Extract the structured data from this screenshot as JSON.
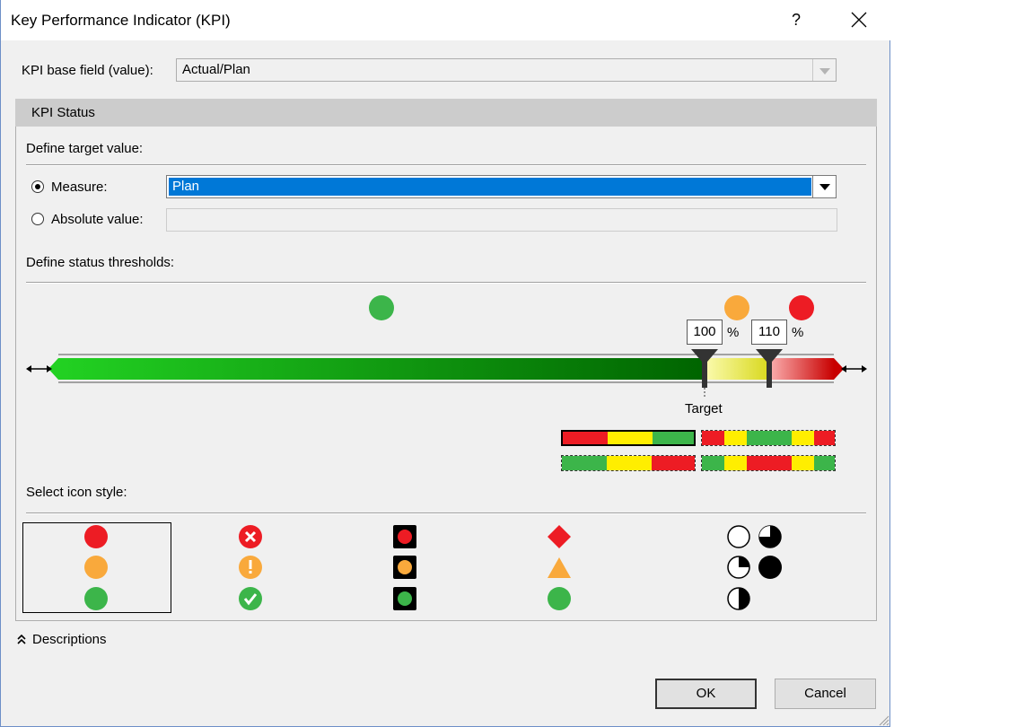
{
  "dialog": {
    "title": "Key Performance Indicator (KPI)",
    "help_label": "?",
    "close_label": "✕"
  },
  "base_field": {
    "label": "KPI base field (value):",
    "value": "Actual/Plan"
  },
  "kpi_status": {
    "header": "KPI Status",
    "define_target_label": "Define target value:",
    "measure_label": "Measure:",
    "measure_value": "Plan",
    "measure_selected": true,
    "absolute_label": "Absolute value:",
    "absolute_value": "",
    "define_thresholds_label": "Define status thresholds:",
    "threshold_low": "100",
    "threshold_high": "110",
    "percent_symbol": "%",
    "target_label": "Target",
    "select_icon_style_label": "Select icon style:"
  },
  "colors": {
    "green": "#3cb54a",
    "orange": "#f9a93c",
    "red": "#ed1c24",
    "yellow": "#ffee00",
    "selected_blue": "#0078d7"
  },
  "icon_styles": [
    {
      "name": "traffic-circles",
      "icons": [
        "red-circle-icon",
        "orange-circle-icon",
        "green-circle-icon"
      ],
      "selected": true
    },
    {
      "name": "symbols",
      "icons": [
        "x-mark-icon",
        "exclamation-icon",
        "check-mark-icon"
      ],
      "selected": false
    },
    {
      "name": "traffic-lights",
      "icons": [
        "red-light-icon",
        "orange-light-icon",
        "green-light-icon"
      ],
      "selected": false
    },
    {
      "name": "shapes",
      "icons": [
        "red-diamond-icon",
        "orange-triangle-icon",
        "green-circle-icon"
      ],
      "selected": false
    },
    {
      "name": "harvey-balls",
      "icons": [
        "empty-ball-icon",
        "quarter-ball-icon",
        "three-quarter-ball-icon",
        "full-ball-icon",
        "half-ball-icon"
      ],
      "selected": false
    }
  ],
  "descriptions_label": "Descriptions",
  "buttons": {
    "ok": "OK",
    "cancel": "Cancel"
  }
}
